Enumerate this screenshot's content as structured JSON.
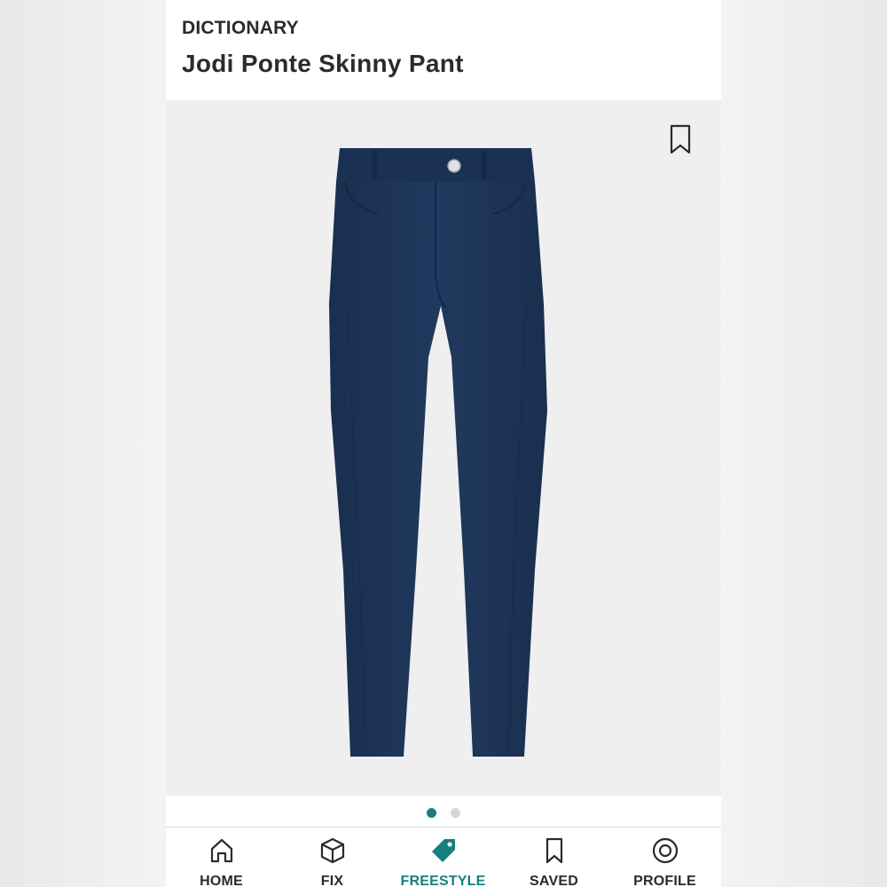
{
  "header": {
    "brand": "DICTIONARY",
    "title": "Jodi Ponte Skinny Pant"
  },
  "product": {
    "image_icon": "navy-skinny-pant-image",
    "bookmark_icon": "bookmark-icon",
    "carousel_pages": 2,
    "carousel_active_index": 0
  },
  "tabs": [
    {
      "label": "HOME",
      "icon": "home-icon",
      "active": false
    },
    {
      "label": "FIX",
      "icon": "box-icon",
      "active": false
    },
    {
      "label": "FREESTYLE",
      "icon": "tag-icon",
      "active": true
    },
    {
      "label": "SAVED",
      "icon": "bookmark-icon",
      "active": false
    },
    {
      "label": "PROFILE",
      "icon": "profile-icon",
      "active": false
    }
  ],
  "colors": {
    "accent": "#17807f",
    "text": "#2b2b2b",
    "pant": "#1d3557",
    "image_bg": "#efefef"
  }
}
